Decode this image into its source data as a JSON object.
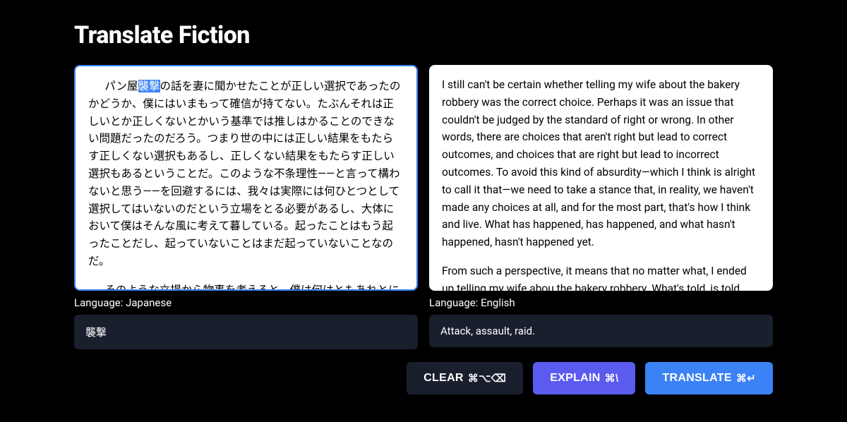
{
  "header": {
    "title": "Translate Fiction"
  },
  "source": {
    "language_label": "Language: Japanese",
    "para1_prefix": "パン屋",
    "para1_highlight": "襲撃",
    "para1_suffix": "の話を妻に聞かせたことが正しい選択であったのかどうか、僕にはいまもって確信が持てない。たぶんそれは正しいとか正しくないとかいう基準では推しはかることのできない問題だったのだろう。つまり世の中には正しい結果をもたらす正しくない選択もあるし、正しくない結果をもたらす正しい選択もあるということだ。このような不条理性――と言って構わないと思う――を回避するには、我々は実際には何ひとつとして選択してはいないのだという立場をとる必要があるし、大体において僕はそんな風に考えて暮している。起ったことはもう起ったことだし、起っていないことはまだ起っていないことなのだ。",
    "para2": "そのような立場から物事を考えると、僕は何はともあれとにかく妻にパン屋襲撃のことを話してしまった――ということになる。話してしまったことは話してしまったことだし、そこから生じた事件は既に生じてしまった事件なのだ。そしてもしその事件が人々の目にもし奇",
    "vocab": "襲撃"
  },
  "target": {
    "language_label": "Language: English",
    "para1": "I still can't be certain whether telling my wife about the bakery robbery was the correct choice. Perhaps it was an issue that couldn't be judged by the standard of right or wrong. In other words, there are choices that aren't right but lead to correct outcomes, and choices that are right but lead to incorrect outcomes. To avoid this kind of absurdity—which I think is alright to call it that—we need to take a stance that, in reality, we haven't made any choices at all, and for the most part, that's how I think and live. What has happened, has happened, and what hasn't happened, hasn't happened yet.",
    "para2_prefix": "From such a perspective, it means that no matter what, I ended up telling my wife ",
    "para2_underlined": "abou",
    "para2_suffix": " the bakery robbery. What's told, is told, and the incidents that arose from it have already occurred. And",
    "vocab": "Attack, assault, raid."
  },
  "buttons": {
    "clear": {
      "label": "CLEAR",
      "shortcut": "⌘⌥⌫"
    },
    "explain": {
      "label": "EXPLAIN",
      "shortcut": "⌘\\"
    },
    "translate": {
      "label": "TRANSLATE",
      "shortcut": "⌘↵"
    }
  }
}
